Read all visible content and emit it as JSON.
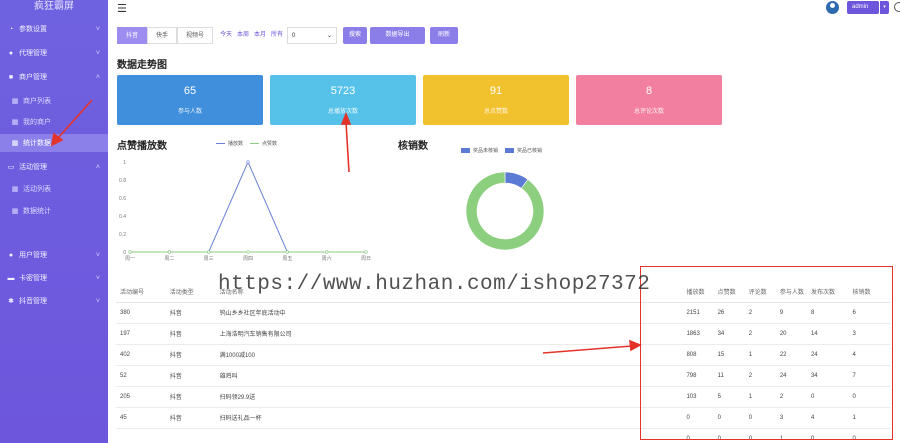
{
  "sidebar": {
    "title": "疯狂霸屏",
    "items": [
      {
        "label": "参数设置",
        "icon": "gauge-icon",
        "has_chevron": true
      },
      {
        "label": "代理管理",
        "icon": "user-icon",
        "has_chevron": true
      },
      {
        "label": "商户管理",
        "icon": "store-icon",
        "has_chevron": true,
        "expanded": true
      },
      {
        "label": "商户列表",
        "icon": "grid-icon",
        "sub": true
      },
      {
        "label": "我的商户",
        "icon": "grid-icon",
        "sub": true
      },
      {
        "label": "统计数据",
        "icon": "grid-icon",
        "sub": true,
        "active": true
      },
      {
        "label": "活动管理",
        "icon": "calendar-icon",
        "has_chevron": true,
        "expanded": true
      },
      {
        "label": "活动列表",
        "icon": "grid-icon",
        "sub": true
      },
      {
        "label": "数据统计",
        "icon": "grid-icon",
        "sub": true
      },
      {
        "label": "用户管理",
        "icon": "user-icon",
        "has_chevron": true
      },
      {
        "label": "卡密管理",
        "icon": "card-icon",
        "has_chevron": true
      },
      {
        "label": "抖音管理",
        "icon": "gear-icon",
        "has_chevron": true
      }
    ]
  },
  "topbar": {
    "admin_label": "admin"
  },
  "filters": {
    "segments": [
      "抖音",
      "快手",
      "视频号"
    ],
    "quick": [
      "今天",
      "本周",
      "本月",
      "所有"
    ],
    "select_value": "0",
    "buttons": {
      "search": "搜索",
      "export": "数据导出",
      "refresh": "刷新"
    }
  },
  "trend": {
    "title": "数据走势图",
    "cards": [
      {
        "value": "65",
        "label": "参与人数",
        "color": "#3f8fdc"
      },
      {
        "value": "5723",
        "label": "总播放次数",
        "color": "#56c2ea"
      },
      {
        "value": "91",
        "label": "总点赞数",
        "color": "#f2c12e"
      },
      {
        "value": "8",
        "label": "总评论次数",
        "color": "#f37fa0"
      }
    ]
  },
  "line_chart_title": "点赞播放数",
  "donut_title": "核销数",
  "chart_data": [
    {
      "type": "line",
      "title": "点赞播放数",
      "x": [
        "周一",
        "周二",
        "周三",
        "周四",
        "周五",
        "周六",
        "周日"
      ],
      "series": [
        {
          "name": "播放数",
          "values": [
            0,
            0,
            0,
            1,
            0,
            0,
            0
          ],
          "color": "#6b82d6"
        },
        {
          "name": "点赞数",
          "values": [
            0,
            0,
            0,
            0,
            0,
            0,
            0
          ],
          "color": "#8ccf7e"
        }
      ],
      "yticks": [
        "0",
        "0.2",
        "0.4",
        "0.6",
        "0.8",
        "1"
      ],
      "ylim": [
        0,
        1
      ],
      "legend": "top",
      "grid": false
    },
    {
      "type": "pie",
      "title": "核销数",
      "donut": true,
      "slices": [
        {
          "name": "奖品未核销",
          "value": 90,
          "color": "#8ccf7e"
        },
        {
          "name": "奖品已核销",
          "value": 10,
          "color": "#5b7bd5"
        }
      ],
      "legend": "top"
    }
  ],
  "table": {
    "headers": [
      "活动编号",
      "活动类型",
      "活动名称",
      "",
      "播放数",
      "点赞数",
      "评论数",
      "参与人数",
      "发布次数",
      "核销数"
    ],
    "rows": [
      [
        "380",
        "抖音",
        "钨山乡乡社区年底活动中",
        "",
        "2151",
        "26",
        "2",
        "9",
        "8",
        "6"
      ],
      [
        "197",
        "抖音",
        "上海浩明汽车销售有限公司",
        "",
        "1863",
        "34",
        "2",
        "20",
        "14",
        "3"
      ],
      [
        "402",
        "抖音",
        "满1000减100",
        "",
        "808",
        "15",
        "1",
        "22",
        "24",
        "4"
      ],
      [
        "52",
        "抖音",
        "雄鸡叫",
        "",
        "798",
        "11",
        "2",
        "24",
        "34",
        "7"
      ],
      [
        "205",
        "抖音",
        "扫码领29.9送",
        "",
        "103",
        "5",
        "1",
        "2",
        "0",
        "0"
      ],
      [
        "45",
        "抖音",
        "扫码送礼品一杯",
        "",
        "0",
        "0",
        "0",
        "3",
        "4",
        "1"
      ],
      [
        "",
        "",
        "",
        "",
        "0",
        "0",
        "0",
        "1",
        "0",
        "0"
      ]
    ]
  },
  "watermark": "https://www.huzhan.com/ishop27372"
}
